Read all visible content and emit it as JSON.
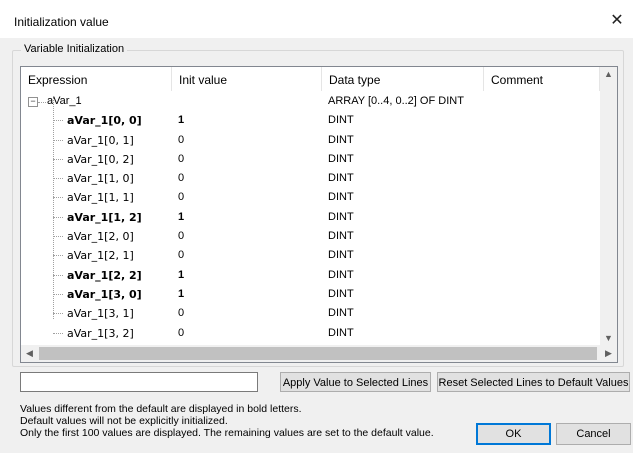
{
  "window": {
    "title": "Initialization value",
    "close_glyph": "✕"
  },
  "group": {
    "label": "Variable Initialization"
  },
  "grid": {
    "columns": [
      "Expression",
      "Init value",
      "Data type",
      "Comment"
    ],
    "root": {
      "expression": "aVar_1",
      "data_type": "ARRAY [0..4, 0..2] OF DINT",
      "expand_glyph": "−"
    },
    "rows": [
      {
        "expression": "aVar_1[0, 0]",
        "init": "1",
        "type": "DINT",
        "bold": true
      },
      {
        "expression": "aVar_1[0, 1]",
        "init": "0",
        "type": "DINT",
        "bold": false
      },
      {
        "expression": "aVar_1[0, 2]",
        "init": "0",
        "type": "DINT",
        "bold": false
      },
      {
        "expression": "aVar_1[1, 0]",
        "init": "0",
        "type": "DINT",
        "bold": false
      },
      {
        "expression": "aVar_1[1, 1]",
        "init": "0",
        "type": "DINT",
        "bold": false
      },
      {
        "expression": "aVar_1[1, 2]",
        "init": "1",
        "type": "DINT",
        "bold": true
      },
      {
        "expression": "aVar_1[2, 0]",
        "init": "0",
        "type": "DINT",
        "bold": false
      },
      {
        "expression": "aVar_1[2, 1]",
        "init": "0",
        "type": "DINT",
        "bold": false
      },
      {
        "expression": "aVar_1[2, 2]",
        "init": "1",
        "type": "DINT",
        "bold": true
      },
      {
        "expression": "aVar_1[3, 0]",
        "init": "1",
        "type": "DINT",
        "bold": true
      },
      {
        "expression": "aVar_1[3, 1]",
        "init": "0",
        "type": "DINT",
        "bold": false
      },
      {
        "expression": "aVar_1[3, 2]",
        "init": "0",
        "type": "DINT",
        "bold": false
      }
    ]
  },
  "value_input": {
    "value": ""
  },
  "buttons": {
    "apply": "Apply Value to Selected Lines",
    "reset": "Reset Selected Lines to Default Values",
    "ok": "OK",
    "cancel": "Cancel"
  },
  "info": [
    "Values different from the default are displayed in bold letters.",
    "Default values will not be explicitly initialized.",
    "Only the first 100 values are displayed. The remaining values are set to the default value."
  ],
  "scroll": {
    "up": "▲",
    "down": "▼",
    "left": "◀",
    "right": "▶"
  },
  "colors": {
    "accent": "#0078d7",
    "window_bg": "#f0f0f0"
  }
}
